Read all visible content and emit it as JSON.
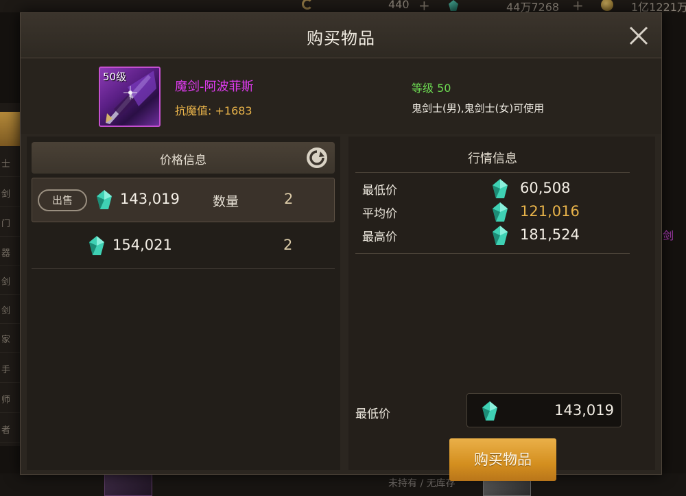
{
  "background": {
    "topbar": {
      "stat1": "440",
      "stat2": "44万7268",
      "stat3": "1亿1221万"
    },
    "sidebar_tabs": [
      "士",
      "剑",
      "门",
      "器",
      "剑",
      "剑",
      "家",
      "手",
      "师",
      "者"
    ],
    "right_text": "剑",
    "bottom_text": "未持有 / 无库存"
  },
  "dialog": {
    "title": "购买物品",
    "item": {
      "level_badge": "50级",
      "name": "魔剑-阿波菲斯",
      "stat": "抗魔值: +1683",
      "grade": "等级 50",
      "usable": "鬼剑士(男),鬼剑士(女)可使用"
    },
    "price_panel": {
      "title": "价格信息",
      "rows": [
        {
          "badge": "出售",
          "price": "143,019",
          "qty_label": "数量",
          "qty": "2"
        },
        {
          "price": "154,021",
          "qty": "2"
        }
      ]
    },
    "market_panel": {
      "title": "行情信息",
      "lowest_label": "最低价",
      "lowest": "60,508",
      "average_label": "平均价",
      "average": "121,016",
      "highest_label": "最高价",
      "highest": "181,524",
      "input_label": "最低价",
      "input_value": "143,019",
      "buy_button": "购买物品"
    }
  },
  "colors": {
    "item_name": "#e03bf1",
    "stat": "#e8b34a",
    "grade": "#6ddc52",
    "buy_button": "#d48f1f",
    "gem": "#3fd1b4"
  },
  "icons": [
    "close-icon",
    "refresh-icon",
    "gem-icon",
    "weapon-icon"
  ]
}
